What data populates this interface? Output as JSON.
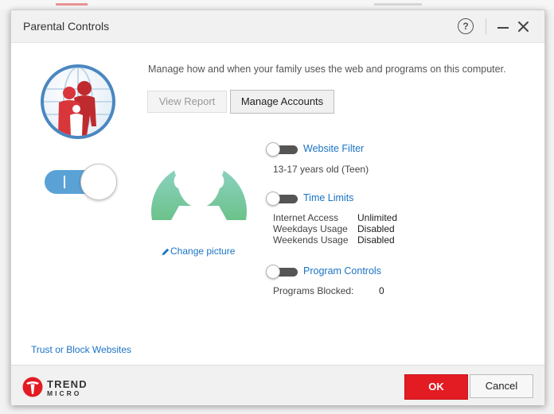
{
  "window": {
    "title": "Parental Controls",
    "help_glyph": "?"
  },
  "intro": {
    "description": "Manage how and when your family uses the web and programs on this computer."
  },
  "buttons": {
    "view_report": "View Report",
    "manage_accounts": "Manage Accounts",
    "ok": "OK",
    "cancel": "Cancel"
  },
  "profile": {
    "change_picture": "Change picture"
  },
  "features": {
    "website_filter": {
      "label": "Website Filter",
      "enabled": false,
      "detail": "13-17 years old (Teen)"
    },
    "time_limits": {
      "label": "Time Limits",
      "enabled": false,
      "rows": [
        {
          "label": "Internet Access",
          "value": "Unlimited"
        },
        {
          "label": "Weekdays Usage",
          "value": "Disabled"
        },
        {
          "label": "Weekends Usage",
          "value": "Disabled"
        }
      ]
    },
    "program_controls": {
      "label": "Program Controls",
      "enabled": false,
      "blocked_label": "Programs Blocked:",
      "blocked_value": "0"
    }
  },
  "master_toggle": {
    "state_glyph": "I",
    "on": true
  },
  "links": {
    "trust_block": "Trust or Block Websites"
  },
  "brand": {
    "line1": "TREND",
    "line2": "MICRO"
  },
  "colors": {
    "accent_red": "#e31b23",
    "link_blue": "#1a73c4",
    "toggle_blue": "#5aa2d6",
    "avatar_top": "#8fd3c7",
    "avatar_bottom": "#6cc28a"
  }
}
